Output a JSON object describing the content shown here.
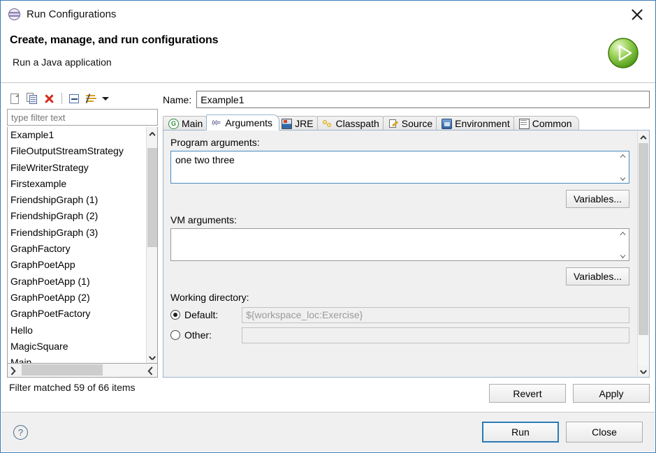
{
  "window": {
    "title": "Run Configurations",
    "icon": "run-config-sphere-icon",
    "close_icon": "close-icon"
  },
  "header": {
    "title": "Create, manage, and run configurations",
    "subtitle": "Run a Java application",
    "run_icon": "green-run-play-icon"
  },
  "left_panel": {
    "toolbar": [
      {
        "name": "new-launch-configuration",
        "icon": "new-document-icon"
      },
      {
        "name": "duplicate-launch-configuration",
        "icon": "copy-pages-icon"
      },
      {
        "name": "delete-launch-configuration",
        "icon": "red-x-delete-icon"
      },
      {
        "name": "collapse-all",
        "icon": "collapse-all-icon"
      },
      {
        "name": "filter-launch-configurations",
        "icon": "filter-arrows-icon"
      },
      {
        "name": "view-menu",
        "icon": "chevron-down-icon"
      }
    ],
    "filter": {
      "placeholder": "type filter text",
      "value": ""
    },
    "items": [
      "Example1",
      "FileOutputStreamStrategy",
      "FileWriterStrategy",
      "Firstexample",
      "FriendshipGraph (1)",
      "FriendshipGraph (2)",
      "FriendshipGraph (3)",
      "GraphFactory",
      "GraphPoetApp",
      "GraphPoetApp (1)",
      "GraphPoetApp (2)",
      "GraphPoetFactory",
      "Hello",
      "MagicSquare",
      "Main"
    ],
    "selected_item": "Example1",
    "status": "Filter matched 59 of 66 items"
  },
  "right_panel": {
    "name_label": "Name:",
    "name_value": "Example1",
    "tabs": [
      {
        "label": "Main",
        "icon": "green-g-circle-icon",
        "active": false
      },
      {
        "label": "Arguments",
        "icon": "variable-args-icon",
        "active": true
      },
      {
        "label": "JRE",
        "icon": "jre-library-icon",
        "active": false
      },
      {
        "label": "Classpath",
        "icon": "classpath-keys-icon",
        "active": false
      },
      {
        "label": "Source",
        "icon": "source-pencil-icon",
        "active": false
      },
      {
        "label": "Environment",
        "icon": "environment-icon",
        "active": false
      },
      {
        "label": "Common",
        "icon": "common-window-icon",
        "active": false
      }
    ],
    "program_arguments": {
      "label": "Program arguments:",
      "value": "one two three",
      "variables_button": "Variables..."
    },
    "vm_arguments": {
      "label": "VM arguments:",
      "value": "",
      "variables_button": "Variables..."
    },
    "working_directory": {
      "label": "Working directory:",
      "default_label": "Default:",
      "default_value": "${workspace_loc:Exercise}",
      "default_selected": true,
      "other_label": "Other:",
      "other_value": "",
      "other_selected": false
    },
    "revert_button": "Revert",
    "apply_button": "Apply"
  },
  "bottom_bar": {
    "help_icon": "question-mark-help-icon",
    "run_button": "Run",
    "close_button": "Close"
  }
}
